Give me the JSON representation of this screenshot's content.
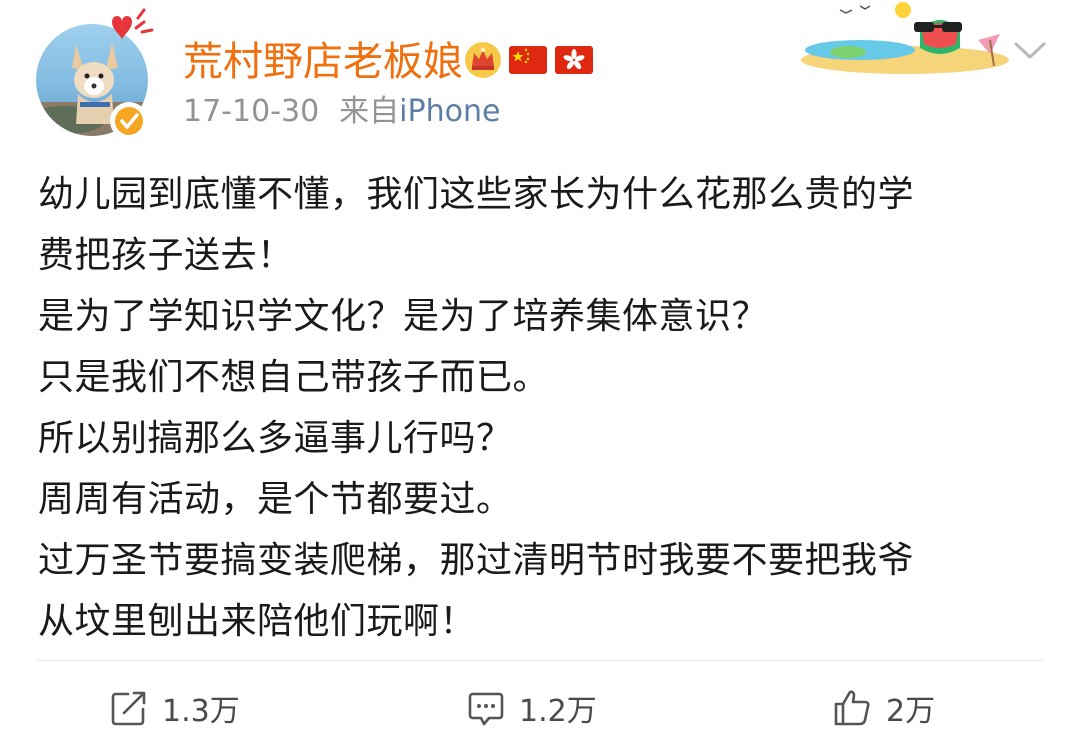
{
  "post": {
    "author": {
      "name": "荒村野店老板娘",
      "avatar_icon": "fennec-fox-avatar",
      "verified_icon": "verified-badge-icon",
      "badges": [
        "crown-icon",
        "china-flag-icon",
        "hong-kong-flag-icon"
      ]
    },
    "date": "17-10-30",
    "source_prefix": "来自",
    "source": "iPhone",
    "body_lines": [
      "幼儿园到底懂不懂，我们这些家长为什么花那么贵的学",
      "费把孩子送去！",
      "是为了学知识学文化？是为了培养集体意识？",
      "只是我们不想自己带孩子而已。",
      "所以别搞那么多逼事儿行吗？",
      "周周有活动，是个节都要过。",
      "过万圣节要搞变装爬梯，那过清明节时我要不要把我爷",
      "从坟里刨出来陪他们玩啊！"
    ]
  },
  "actions": {
    "repost": {
      "icon": "repost-icon",
      "count": "1.3万"
    },
    "comment": {
      "icon": "comment-icon",
      "count": "1.2万"
    },
    "like": {
      "icon": "like-icon",
      "count": "2万"
    }
  },
  "colors": {
    "username": "#f0700f",
    "meta": "#939393",
    "source": "#5d7fa6",
    "body": "#1a1a1a",
    "divider": "#e6e6e6"
  }
}
